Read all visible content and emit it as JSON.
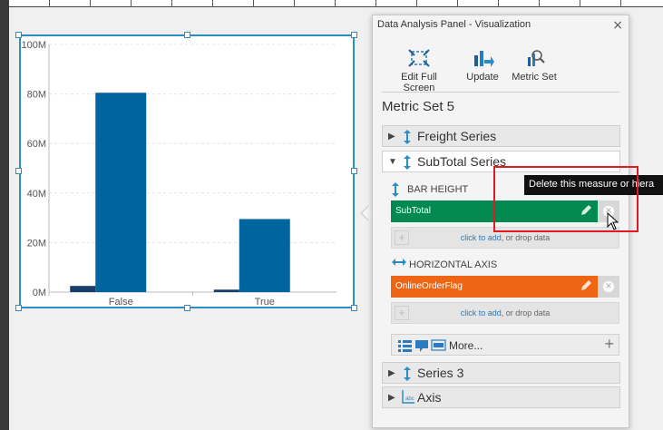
{
  "chart_data": {
    "type": "bar",
    "categories": [
      "False",
      "True"
    ],
    "series": [
      {
        "values": [
          2.5,
          1.0
        ],
        "color": "#183e6b"
      },
      {
        "values": [
          80.5,
          29.5
        ],
        "color": "#00649e"
      }
    ],
    "ylim": [
      0,
      100
    ],
    "yticks": [
      "0M",
      "20M",
      "40M",
      "60M",
      "80M",
      "100M"
    ],
    "grid": true
  },
  "panel": {
    "title": "Data Analysis Panel - Visualization",
    "close_glyph": "×",
    "toolbar": [
      {
        "label": "Edit Full Screen",
        "icon": "edit-full-screen-icon"
      },
      {
        "label": "Update",
        "icon": "update-icon"
      },
      {
        "label": "Metric Set",
        "icon": "metric-set-icon"
      }
    ],
    "metric_set_title": "Metric Set 5",
    "series": {
      "freight": "Freight Series",
      "subtotal": "SubTotal Series",
      "series3": "Series 3",
      "axis": "Axis"
    },
    "bar_height_label": "BAR HEIGHT",
    "bar_height_field": "SubTotal",
    "horizontal_axis_label": "HORIZONTAL AXIS",
    "horizontal_axis_field": "OnlineOrderFlag",
    "drop_link": "click to add",
    "drop_rest": ", or drop data",
    "more_label": "More...",
    "tooltip": "Delete this measure or hiera"
  },
  "colors": {
    "measure": "#008a4f",
    "hierarchy": "#ee6514",
    "accent": "#2a8dc5",
    "highlight": "#e01a22"
  }
}
